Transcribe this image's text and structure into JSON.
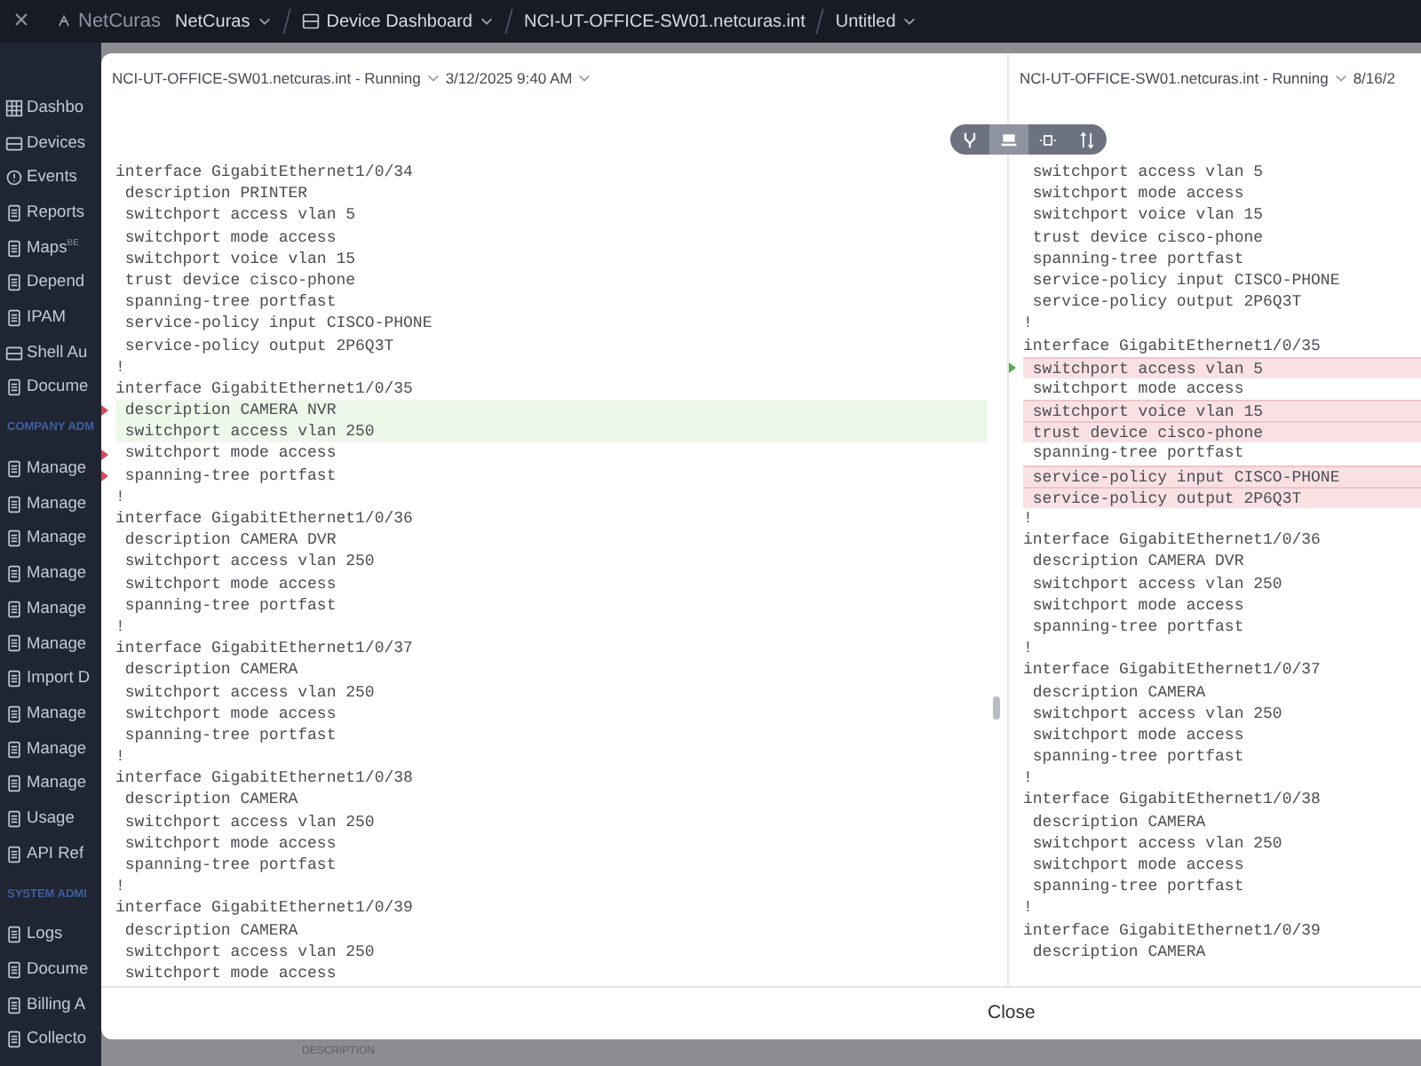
{
  "top_bar": {
    "close": "×",
    "logo": "NetCuras",
    "breadcrumbs": [
      {
        "label": "NetCuras",
        "icon": false,
        "caret": true
      },
      {
        "label": "Device Dashboard",
        "icon": true,
        "caret": true
      },
      {
        "label": "NCI-UT-OFFICE-SW01.netcuras.int",
        "icon": false,
        "caret": false
      },
      {
        "label": "Untitled",
        "icon": false,
        "caret": true
      }
    ]
  },
  "sidebar": {
    "items": [
      {
        "kind": "item",
        "label": "Dashbo"
      },
      {
        "kind": "item",
        "label": "Devices"
      },
      {
        "kind": "item",
        "label": "Events"
      },
      {
        "kind": "item",
        "label": "Reports"
      },
      {
        "kind": "item",
        "label": "Maps",
        "badge": "BE"
      },
      {
        "kind": "item",
        "label": "Depend"
      },
      {
        "kind": "item",
        "label": "IPAM"
      },
      {
        "kind": "item",
        "label": "Shell Au"
      },
      {
        "kind": "item",
        "label": "Docume"
      },
      {
        "kind": "section",
        "label": "COMPANY ADM"
      },
      {
        "kind": "item",
        "label": "Manage"
      },
      {
        "kind": "item",
        "label": "Manage"
      },
      {
        "kind": "item",
        "label": "Manage"
      },
      {
        "kind": "item",
        "label": "Manage"
      },
      {
        "kind": "item",
        "label": "Manage"
      },
      {
        "kind": "item",
        "label": "Manage"
      },
      {
        "kind": "item",
        "label": "Import D"
      },
      {
        "kind": "item",
        "label": "Manage"
      },
      {
        "kind": "item",
        "label": "Manage"
      },
      {
        "kind": "item",
        "label": "Manage"
      },
      {
        "kind": "item",
        "label": "Usage"
      },
      {
        "kind": "item",
        "label": "API Ref"
      },
      {
        "kind": "section",
        "label": "SYSTEM ADMI"
      },
      {
        "kind": "item",
        "label": "Logs"
      },
      {
        "kind": "item",
        "label": "Docume"
      },
      {
        "kind": "item",
        "label": "Billing A"
      },
      {
        "kind": "item",
        "label": "Collecto"
      }
    ]
  },
  "background_label": "DESCRIPTION",
  "modal": {
    "toolbar": [
      {
        "selected": false
      },
      {
        "selected": true
      },
      {
        "selected": false
      },
      {
        "selected": false
      }
    ],
    "panes": [
      {
        "title": "NCI-UT-OFFICE-SW01.netcuras.int - Running",
        "date": "3/12/2025 9:40 AM",
        "lines": [
          {
            "text": "interface GigabitEthernet1/0/34",
            "kind": "plain",
            "marker": false
          },
          {
            "text": " description PRINTER",
            "kind": "plain",
            "marker": false
          },
          {
            "text": " switchport access vlan 5",
            "kind": "plain",
            "marker": false
          },
          {
            "text": " switchport mode access",
            "kind": "plain",
            "marker": false
          },
          {
            "text": " switchport voice vlan 15",
            "kind": "plain",
            "marker": false
          },
          {
            "text": " trust device cisco-phone",
            "kind": "plain",
            "marker": false
          },
          {
            "text": " spanning-tree portfast",
            "kind": "plain",
            "marker": false
          },
          {
            "text": " service-policy input CISCO-PHONE",
            "kind": "plain",
            "marker": false
          },
          {
            "text": " service-policy output 2P6Q3T",
            "kind": "plain",
            "marker": false
          },
          {
            "text": "!",
            "kind": "plain",
            "marker": false
          },
          {
            "text": "interface GigabitEthernet1/0/35",
            "kind": "plain",
            "marker": false
          },
          {
            "text": " description CAMERA NVR",
            "kind": "added",
            "marker": true
          },
          {
            "text": " switchport access vlan 250",
            "kind": "added",
            "marker": false
          },
          {
            "text": " switchport mode access",
            "kind": "plain",
            "marker": true
          },
          {
            "text": " spanning-tree portfast",
            "kind": "plain",
            "marker": true
          },
          {
            "text": "!",
            "kind": "plain",
            "marker": false
          },
          {
            "text": "interface GigabitEthernet1/0/36",
            "kind": "plain",
            "marker": false
          },
          {
            "text": " description CAMERA DVR",
            "kind": "plain",
            "marker": false
          },
          {
            "text": " switchport access vlan 250",
            "kind": "plain",
            "marker": false
          },
          {
            "text": " switchport mode access",
            "kind": "plain",
            "marker": false
          },
          {
            "text": " spanning-tree portfast",
            "kind": "plain",
            "marker": false
          },
          {
            "text": "!",
            "kind": "plain",
            "marker": false
          },
          {
            "text": "interface GigabitEthernet1/0/37",
            "kind": "plain",
            "marker": false
          },
          {
            "text": " description CAMERA",
            "kind": "plain",
            "marker": false
          },
          {
            "text": " switchport access vlan 250",
            "kind": "plain",
            "marker": false
          },
          {
            "text": " switchport mode access",
            "kind": "plain",
            "marker": false
          },
          {
            "text": " spanning-tree portfast",
            "kind": "plain",
            "marker": false
          },
          {
            "text": "!",
            "kind": "plain",
            "marker": false
          },
          {
            "text": "interface GigabitEthernet1/0/38",
            "kind": "plain",
            "marker": false
          },
          {
            "text": " description CAMERA",
            "kind": "plain",
            "marker": false
          },
          {
            "text": " switchport access vlan 250",
            "kind": "plain",
            "marker": false
          },
          {
            "text": " switchport mode access",
            "kind": "plain",
            "marker": false
          },
          {
            "text": " spanning-tree portfast",
            "kind": "plain",
            "marker": false
          },
          {
            "text": "!",
            "kind": "plain",
            "marker": false
          },
          {
            "text": "interface GigabitEthernet1/0/39",
            "kind": "plain",
            "marker": false
          },
          {
            "text": " description CAMERA",
            "kind": "plain",
            "marker": false
          },
          {
            "text": " switchport access vlan 250",
            "kind": "plain",
            "marker": false
          },
          {
            "text": " switchport mode access",
            "kind": "plain",
            "marker": false
          }
        ]
      },
      {
        "title": "NCI-UT-OFFICE-SW01.netcuras.int - Running",
        "date": "8/16/2",
        "lines": [
          {
            "text": " switchport access vlan 5",
            "kind": "plain",
            "marker": false
          },
          {
            "text": " switchport mode access",
            "kind": "plain",
            "marker": false
          },
          {
            "text": " switchport voice vlan 15",
            "kind": "plain",
            "marker": false
          },
          {
            "text": " trust device cisco-phone",
            "kind": "plain",
            "marker": false
          },
          {
            "text": " spanning-tree portfast",
            "kind": "plain",
            "marker": false
          },
          {
            "text": " service-policy input CISCO-PHONE",
            "kind": "plain",
            "marker": false
          },
          {
            "text": " service-policy output 2P6Q3T",
            "kind": "plain",
            "marker": false
          },
          {
            "text": "!",
            "kind": "plain",
            "marker": false
          },
          {
            "text": "interface GigabitEthernet1/0/35",
            "kind": "plain",
            "marker": false
          },
          {
            "text": " switchport access vlan 5",
            "kind": "removed",
            "marker": true
          },
          {
            "text": " switchport mode access",
            "kind": "plain",
            "marker": false
          },
          {
            "text": " switchport voice vlan 15",
            "kind": "removed",
            "marker": false
          },
          {
            "text": " trust device cisco-phone",
            "kind": "removed",
            "marker": false
          },
          {
            "text": " spanning-tree portfast",
            "kind": "plain",
            "marker": false
          },
          {
            "text": " service-policy input CISCO-PHONE",
            "kind": "removed",
            "marker": false
          },
          {
            "text": " service-policy output 2P6Q3T",
            "kind": "removed",
            "marker": false
          },
          {
            "text": "!",
            "kind": "plain",
            "marker": false
          },
          {
            "text": "interface GigabitEthernet1/0/36",
            "kind": "plain",
            "marker": false
          },
          {
            "text": " description CAMERA DVR",
            "kind": "plain",
            "marker": false
          },
          {
            "text": " switchport access vlan 250",
            "kind": "plain",
            "marker": false
          },
          {
            "text": " switchport mode access",
            "kind": "plain",
            "marker": false
          },
          {
            "text": " spanning-tree portfast",
            "kind": "plain",
            "marker": false
          },
          {
            "text": "!",
            "kind": "plain",
            "marker": false
          },
          {
            "text": "interface GigabitEthernet1/0/37",
            "kind": "plain",
            "marker": false
          },
          {
            "text": " description CAMERA",
            "kind": "plain",
            "marker": false
          },
          {
            "text": " switchport access vlan 250",
            "kind": "plain",
            "marker": false
          },
          {
            "text": " switchport mode access",
            "kind": "plain",
            "marker": false
          },
          {
            "text": " spanning-tree portfast",
            "kind": "plain",
            "marker": false
          },
          {
            "text": "!",
            "kind": "plain",
            "marker": false
          },
          {
            "text": "interface GigabitEthernet1/0/38",
            "kind": "plain",
            "marker": false
          },
          {
            "text": " description CAMERA",
            "kind": "plain",
            "marker": false
          },
          {
            "text": " switchport access vlan 250",
            "kind": "plain",
            "marker": false
          },
          {
            "text": " switchport mode access",
            "kind": "plain",
            "marker": false
          },
          {
            "text": " spanning-tree portfast",
            "kind": "plain",
            "marker": false
          },
          {
            "text": "!",
            "kind": "plain",
            "marker": false
          },
          {
            "text": "interface GigabitEthernet1/0/39",
            "kind": "plain",
            "marker": false
          },
          {
            "text": " description CAMERA",
            "kind": "plain",
            "marker": false
          }
        ]
      }
    ],
    "close_button": "Close"
  }
}
